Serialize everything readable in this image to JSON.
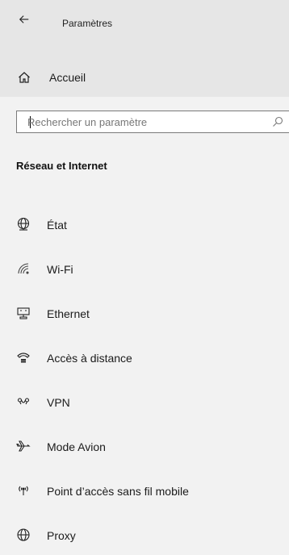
{
  "window": {
    "title": "Paramètres"
  },
  "home": {
    "label": "Accueil",
    "icon": "home-icon"
  },
  "search": {
    "placeholder": "Rechercher un paramètre",
    "value": ""
  },
  "section": {
    "title": "Réseau et Internet"
  },
  "nav": {
    "items": [
      {
        "label": "État",
        "icon": "status-globe-icon"
      },
      {
        "label": "Wi-Fi",
        "icon": "wifi-icon"
      },
      {
        "label": "Ethernet",
        "icon": "ethernet-icon"
      },
      {
        "label": "Accès à distance",
        "icon": "dial-up-icon"
      },
      {
        "label": "VPN",
        "icon": "vpn-icon"
      },
      {
        "label": "Mode Avion",
        "icon": "airplane-icon"
      },
      {
        "label": "Point d’accès sans fil mobile",
        "icon": "hotspot-icon"
      },
      {
        "label": "Proxy",
        "icon": "globe-icon"
      }
    ]
  }
}
